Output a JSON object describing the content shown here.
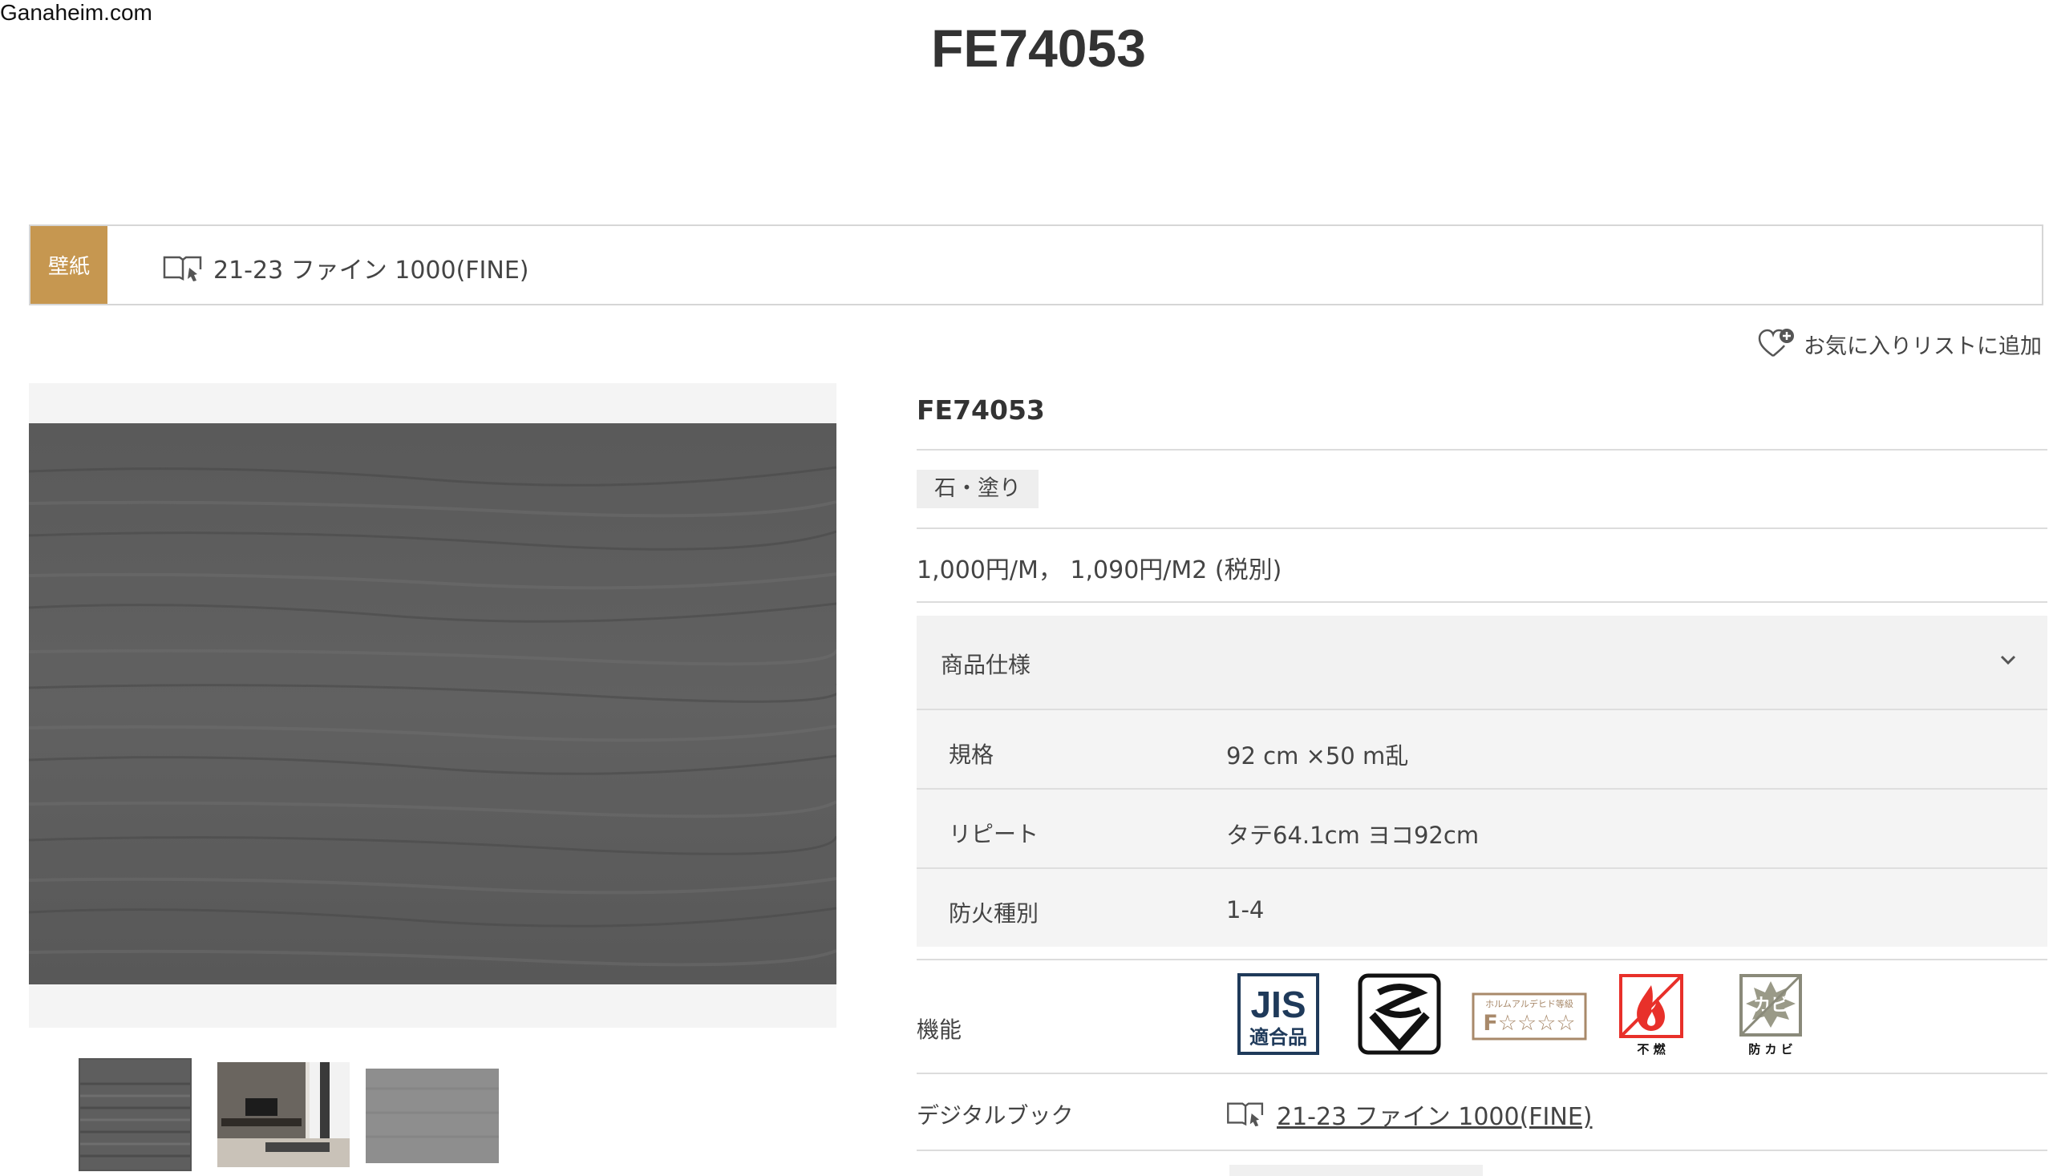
{
  "site": {
    "label": "Ganaheim.com"
  },
  "page": {
    "title": "FE74053"
  },
  "category": {
    "badge": "壁紙",
    "book_name": "21-23 ファイン 1000(FINE)"
  },
  "favorite": {
    "label": "お気に入りリストに追加"
  },
  "product": {
    "code": "FE74053",
    "tag": "石・塗り",
    "price": "1,000円/M，  1,090円/M2 (税別)"
  },
  "specs": {
    "heading": "商品仕様",
    "rows": [
      {
        "key": "規格",
        "value": "92 cm ×50 m乱"
      },
      {
        "key": "リピート",
        "value": "タテ64.1cm ヨコ92cm"
      },
      {
        "key": "防火種別",
        "value": "1-4"
      }
    ]
  },
  "features": {
    "label": "機能",
    "icons": {
      "jis_top": "JIS",
      "jis_bottom": "適合品",
      "formaldehyde_top": "ホルムアルデヒド等級",
      "formaldehyde_grade": "F☆☆☆☆",
      "fireproof_caption": "不 燃",
      "antimold_text": "カビ",
      "antimold_caption": "防 カ ビ"
    }
  },
  "digital_book": {
    "label": "デジタルブック",
    "link": "21-23 ファイン 1000(FINE)"
  },
  "colors": {
    "badge": "#c69750",
    "fire": "#e8302a"
  }
}
